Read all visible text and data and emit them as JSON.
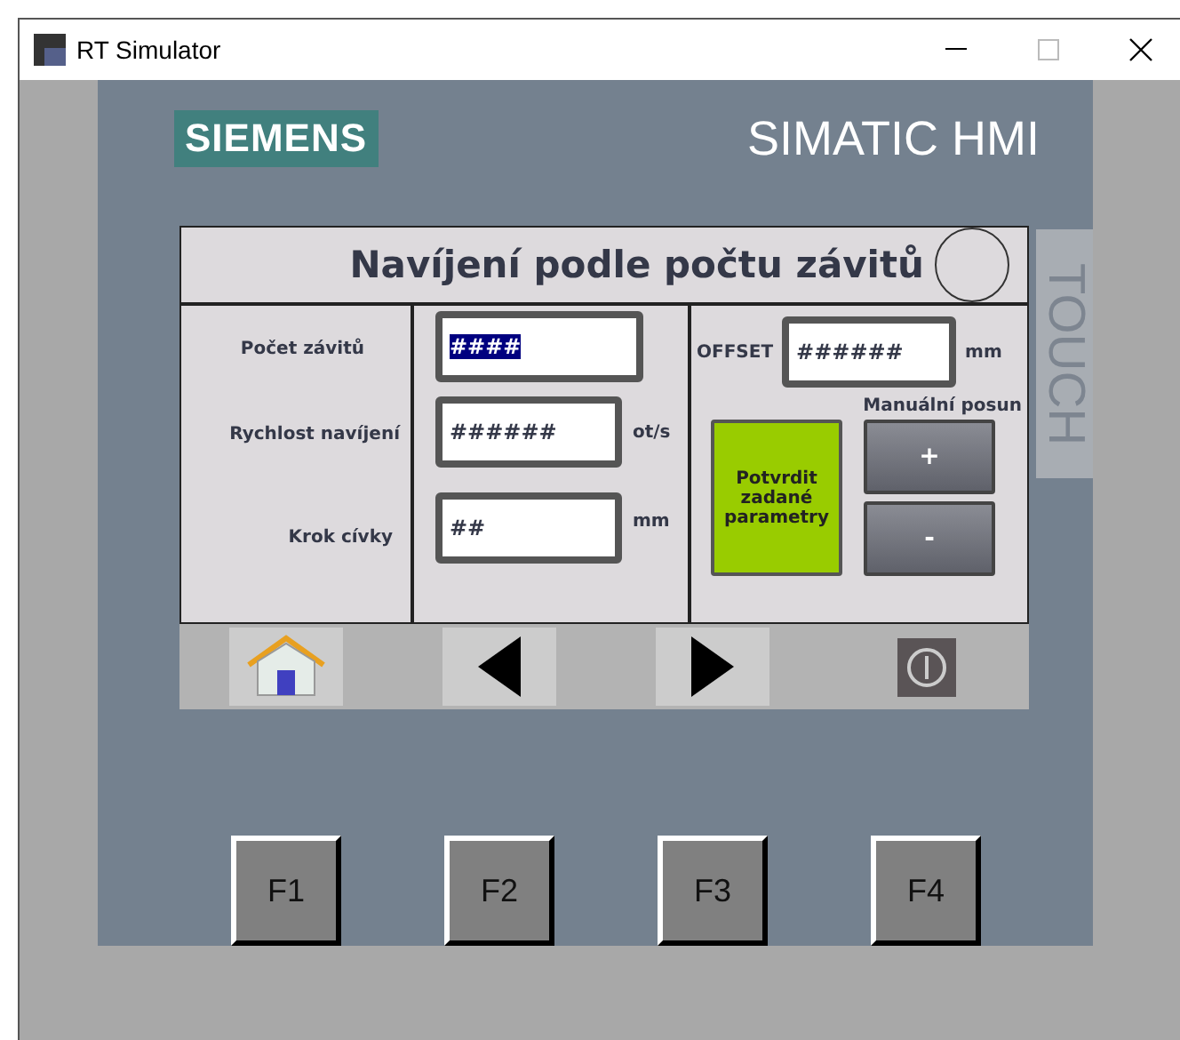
{
  "window": {
    "title": "RT Simulator"
  },
  "panel": {
    "logo": "SIEMENS",
    "product": "SIMATIC HMI",
    "side_label": "TOUCH"
  },
  "screen": {
    "title": "Navíjení podle počtu závitů",
    "fields": [
      {
        "label": "Počet závitů",
        "value": "####",
        "selected": true
      },
      {
        "label": "Rychlost navíjení",
        "value": "######",
        "unit": "ot/s",
        "selected": false
      },
      {
        "label": "Krok cívky",
        "value": "##",
        "unit": "mm",
        "selected": false
      }
    ],
    "offset": {
      "label": "OFFSET",
      "value": "######",
      "unit": "mm"
    },
    "manual_label": "Manuální posun",
    "confirm_button": "Potvrdit zadané parametry",
    "jog_buttons": [
      "+",
      "-"
    ],
    "nav": [
      {
        "kind": "home"
      },
      {
        "kind": "back"
      },
      {
        "kind": "forward"
      },
      {
        "kind": "power"
      }
    ]
  },
  "function_keys": [
    "F1",
    "F2",
    "F3",
    "F4"
  ]
}
